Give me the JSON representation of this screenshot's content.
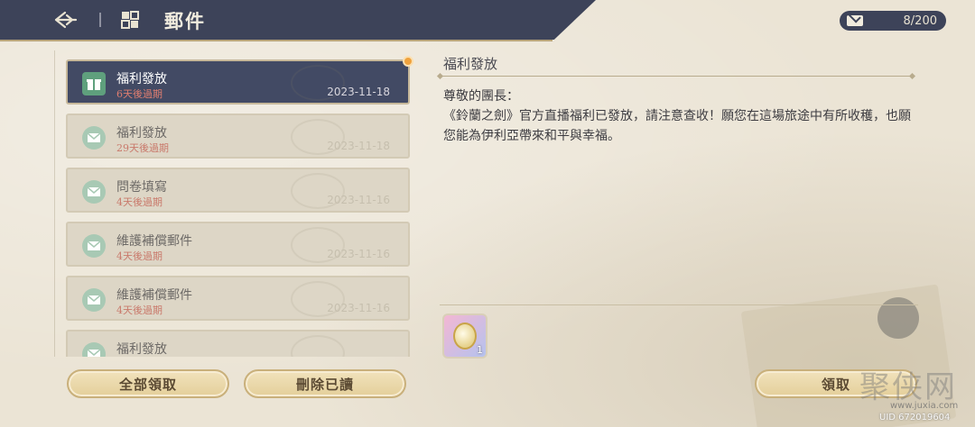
{
  "header": {
    "title": "郵件",
    "counter": "8/200"
  },
  "mails": [
    {
      "title": "福利發放",
      "expires": "6天後過期",
      "date": "2023-11-18",
      "selected": true
    },
    {
      "title": "福利發放",
      "expires": "29天後過期",
      "date": "2023-11-18",
      "selected": false
    },
    {
      "title": "問卷填寫",
      "expires": "4天後過期",
      "date": "2023-11-16",
      "selected": false
    },
    {
      "title": "維護補償郵件",
      "expires": "4天後過期",
      "date": "2023-11-16",
      "selected": false
    },
    {
      "title": "維護補償郵件",
      "expires": "4天後過期",
      "date": "2023-11-16",
      "selected": false
    },
    {
      "title": "福利發放",
      "expires": "",
      "date": "",
      "selected": false
    }
  ],
  "buttons": {
    "claim_all": "全部領取",
    "delete_read": "刪除已讀",
    "claim": "領取"
  },
  "content": {
    "title": "福利發放",
    "greeting": "尊敬的團長：",
    "body": "《鈴蘭之劍》官方直播福利已發放，請注意查收！願您在這場旅途中有所收穫，也願您能為伊利亞帶來和平與幸福。",
    "attachment_qty": "1"
  },
  "watermark": {
    "logo": "聚侠网",
    "url": "www.juxia.com",
    "uid": "UID 672019604"
  },
  "colors": {
    "header_bg": "#3d4359",
    "selected_item": "#424a64",
    "expire_red": "#c9796b",
    "button_gold": "#e4cf9a"
  }
}
